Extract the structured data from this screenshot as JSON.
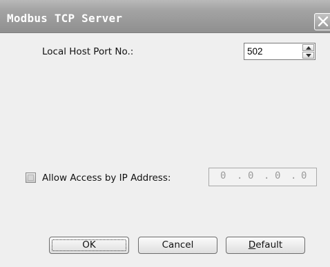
{
  "window": {
    "title": "Modbus TCP Server"
  },
  "port": {
    "label": "Local Host Port No.:",
    "value": "502"
  },
  "access": {
    "label": "Allow Access by IP Address:",
    "checked": false,
    "ip_octets": [
      "0",
      "0",
      "0",
      "0"
    ],
    "separator": "."
  },
  "buttons": {
    "ok": "OK",
    "cancel": "Cancel",
    "default_prefix": "D",
    "default_rest": "efault"
  }
}
